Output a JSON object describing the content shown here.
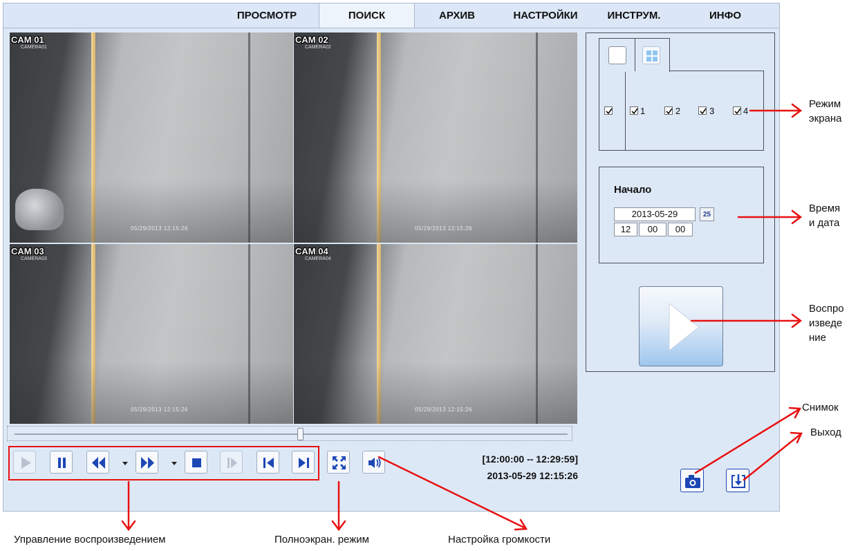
{
  "tabs": [
    "ПРОСМОТР",
    "ПОИСК",
    "АРХИВ",
    "НАСТРОЙКИ",
    "ИНСТРУМ.",
    "ИНФО"
  ],
  "active_tab": "ПОИСК",
  "cameras": [
    {
      "label": "CAM 01",
      "sub": "CAMERA01",
      "timestamp": "05/29/2013 12:15:26"
    },
    {
      "label": "CAM 02",
      "sub": "CAMERA02",
      "timestamp": "05/29/2013 12:15:26"
    },
    {
      "label": "CAM 03",
      "sub": "CAMERA03",
      "timestamp": "05/29/2013 12:15:26"
    },
    {
      "label": "CAM 04",
      "sub": "CAMERA04",
      "timestamp": "05/29/2013 12:15:26"
    }
  ],
  "selected_camera": 2,
  "timeline": {
    "position_fraction": 0.52
  },
  "time_range": "[12:00:00 -- 12:29:59]",
  "current_time": "2013-05-29 12:15:26",
  "screen_mode": {
    "channels": [
      "1",
      "2",
      "3",
      "4"
    ],
    "all_checked": true
  },
  "start": {
    "title": "Начало",
    "date": "2013-05-29",
    "calendar_day": "25",
    "hour": "12",
    "minute": "00",
    "second": "00"
  },
  "annotations": {
    "screen_mode": "Режим экрана",
    "time_date": "Время и дата",
    "playback": "Воспро изведе ние",
    "snapshot": "Снимок",
    "exit": "Выход",
    "playback_control": "Управление воспроизведением",
    "fullscreen": "Полноэкран. режим",
    "volume": "Настройка громкости"
  },
  "colors": {
    "panel": "#dde8f6",
    "button_icon": "#1d47b5",
    "annotation": "#e81010",
    "selected_camera_border": "#1b2d8f"
  },
  "icons": [
    "play-icon",
    "pause-icon",
    "rewind-icon",
    "fast-forward-icon",
    "stop-icon",
    "step-forward-icon",
    "skip-start-icon",
    "skip-end-icon",
    "fullscreen-icon",
    "volume-icon",
    "camera-icon",
    "exit-icon",
    "calendar-icon"
  ]
}
